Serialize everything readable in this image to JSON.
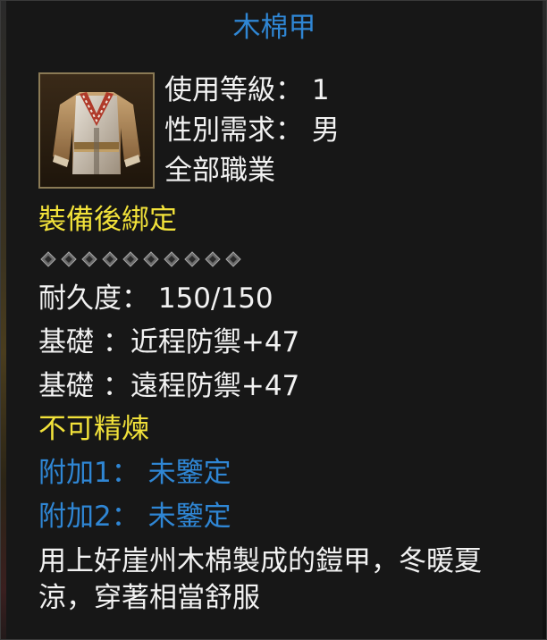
{
  "item": {
    "name": "木棉甲",
    "icon": "cloth-armor-icon",
    "requirements": {
      "level": "使用等級： 1",
      "gender": "性別需求： 男",
      "class": "全部職業"
    },
    "bind": "裝備後綁定",
    "enhance_slots": 10,
    "durability": "耐久度： 150/150",
    "base_stats": [
      "基礎 ：近程防禦+47",
      "基礎 ：遠程防禦+47"
    ],
    "refine": "不可精煉",
    "extras": [
      "附加1： 未鑒定",
      "附加2： 未鑒定"
    ],
    "description": "用上好崖州木棉製成的鎧甲，冬暖夏涼，穿著相當舒服"
  },
  "colors": {
    "title": "#2f86d4",
    "yellow": "#f2e23a",
    "blue": "#2f86d4",
    "white": "#f2f2f2"
  }
}
